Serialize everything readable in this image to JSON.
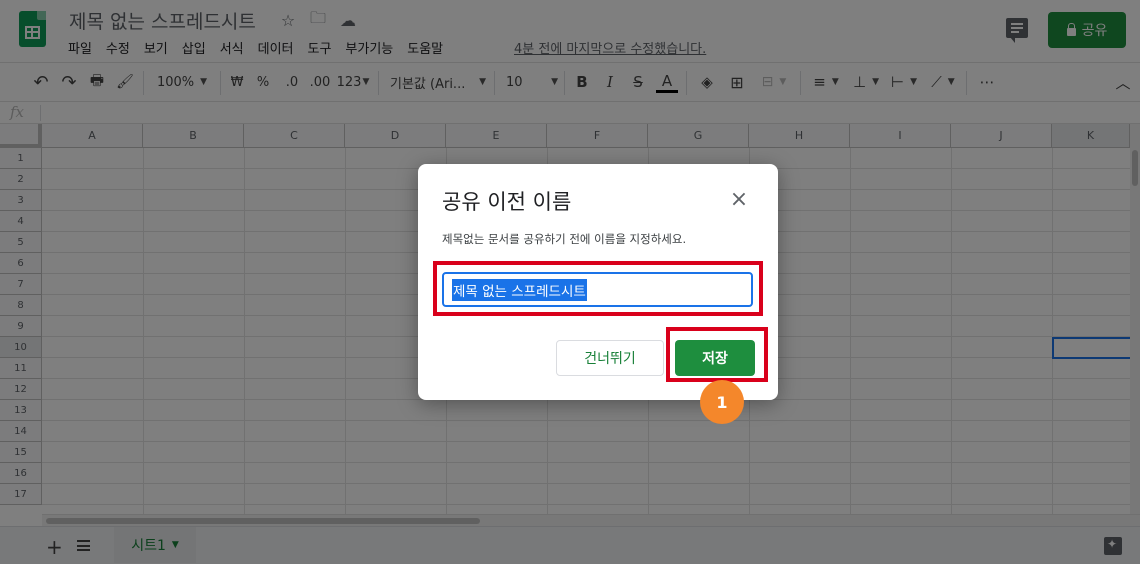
{
  "header": {
    "doc_title": "제목 없는 스프레드시트",
    "menus": [
      "파일",
      "수정",
      "보기",
      "삽입",
      "서식",
      "데이터",
      "도구",
      "부가기능",
      "도움말"
    ],
    "last_edit": "4분 전에 마지막으로 수정했습니다.",
    "share_label": "공유"
  },
  "toolbar": {
    "zoom": "100%",
    "currency": "₩",
    "percent": "%",
    "decimal_decrease": ".0",
    "decimal_increase": ".00",
    "format": "123",
    "font": "기본값 (Ari...",
    "font_size": "10",
    "bold": "B",
    "italic": "I",
    "strike": "S",
    "text_color": "A",
    "more": "⋯"
  },
  "formula_bar": {
    "fx": "fx"
  },
  "grid": {
    "columns": [
      "A",
      "B",
      "C",
      "D",
      "E",
      "F",
      "G",
      "H",
      "I",
      "J",
      "K"
    ],
    "rows": [
      "1",
      "2",
      "3",
      "4",
      "5",
      "6",
      "7",
      "8",
      "9",
      "10",
      "11",
      "12",
      "13",
      "14",
      "15",
      "16",
      "17"
    ],
    "selected": "K10"
  },
  "sheetbar": {
    "add": "+",
    "tab_label": "시트1"
  },
  "dialog": {
    "title": "공유 이전 이름",
    "close": "×",
    "description": "제목없는 문서를 공유하기 전에 이름을 지정하세요.",
    "input_value": "제목 없는 스프레드시트",
    "skip_label": "건너뛰기",
    "save_label": "저장"
  },
  "annotation": {
    "badge": "1"
  },
  "colors": {
    "accent_green": "#1e8e3e",
    "highlight_red": "#d9001b",
    "badge_orange": "#f4872b",
    "selection_blue": "#1a73e8"
  }
}
